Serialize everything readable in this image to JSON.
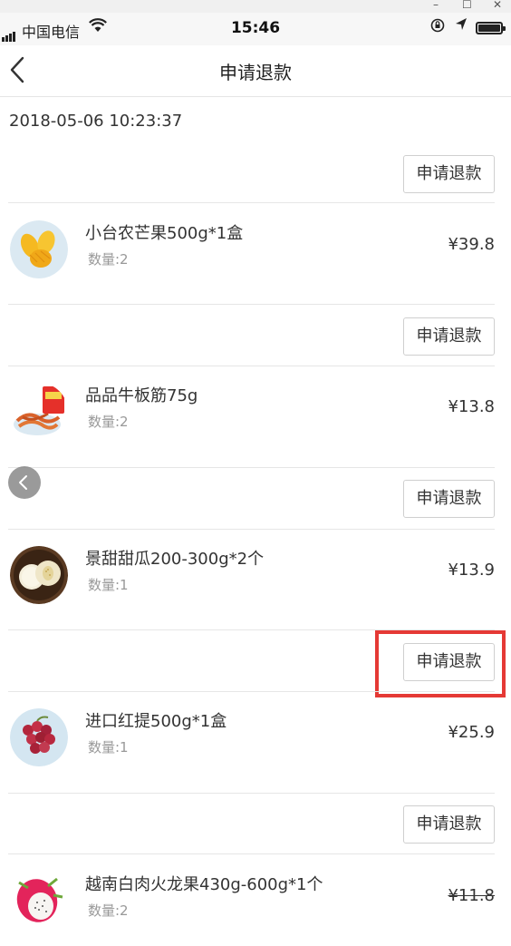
{
  "status_bar": {
    "carrier": "中国电信",
    "time": "15:46"
  },
  "navbar": {
    "title": "申请退款"
  },
  "order": {
    "date": "2018-05-06 10:23:37"
  },
  "refund_label": "申请退款",
  "items": [
    {
      "name": "小台农芒果500g*1盒",
      "qty": "数量:2",
      "price": "¥39.8",
      "icon": "mango-image"
    },
    {
      "name": "品品牛板筋75g",
      "qty": "数量:2",
      "price": "¥13.8",
      "icon": "beef-tendon-image"
    },
    {
      "name": "景甜甜瓜200-300g*2个",
      "qty": "数量:1",
      "price": "¥13.9",
      "icon": "melon-image"
    },
    {
      "name": "进口红提500g*1盒",
      "qty": "数量:1",
      "price": "¥25.9",
      "icon": "red-grape-image"
    },
    {
      "name": "越南白肉火龙果430g-600g*1个",
      "qty": "数量:2",
      "price": "¥11.8",
      "icon": "dragon-fruit-image"
    }
  ],
  "colors": {
    "highlight": "#e53935",
    "divider": "#e6e6e6",
    "secondary_text": "#999999"
  }
}
